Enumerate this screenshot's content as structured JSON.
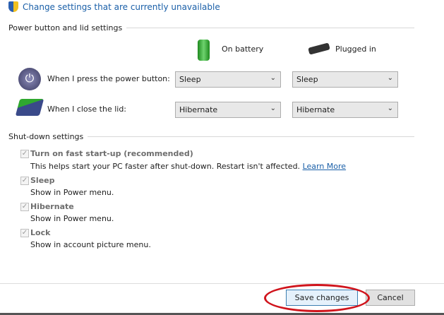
{
  "header": {
    "change_settings_link": "Change settings that are currently unavailable"
  },
  "power_section": {
    "title": "Power button and lid settings",
    "col_battery": "On battery",
    "col_plugged": "Plugged in",
    "rows": [
      {
        "label": "When I press the power button:",
        "battery": "Sleep",
        "plugged": "Sleep"
      },
      {
        "label": "When I close the lid:",
        "battery": "Hibernate",
        "plugged": "Hibernate"
      }
    ]
  },
  "shutdown_section": {
    "title": "Shut-down settings",
    "items": [
      {
        "label": "Turn on fast start-up (recommended)",
        "desc": "This helps start your PC faster after shut-down. Restart isn't affected.",
        "link": "Learn More",
        "checked": true
      },
      {
        "label": "Sleep",
        "desc": "Show in Power menu.",
        "checked": true
      },
      {
        "label": "Hibernate",
        "desc": "Show in Power menu.",
        "checked": true
      },
      {
        "label": "Lock",
        "desc": "Show in account picture menu.",
        "checked": true
      }
    ]
  },
  "footer": {
    "save": "Save changes",
    "cancel": "Cancel"
  },
  "colors": {
    "link": "#1a5fa8",
    "highlight": "#d0141c"
  }
}
